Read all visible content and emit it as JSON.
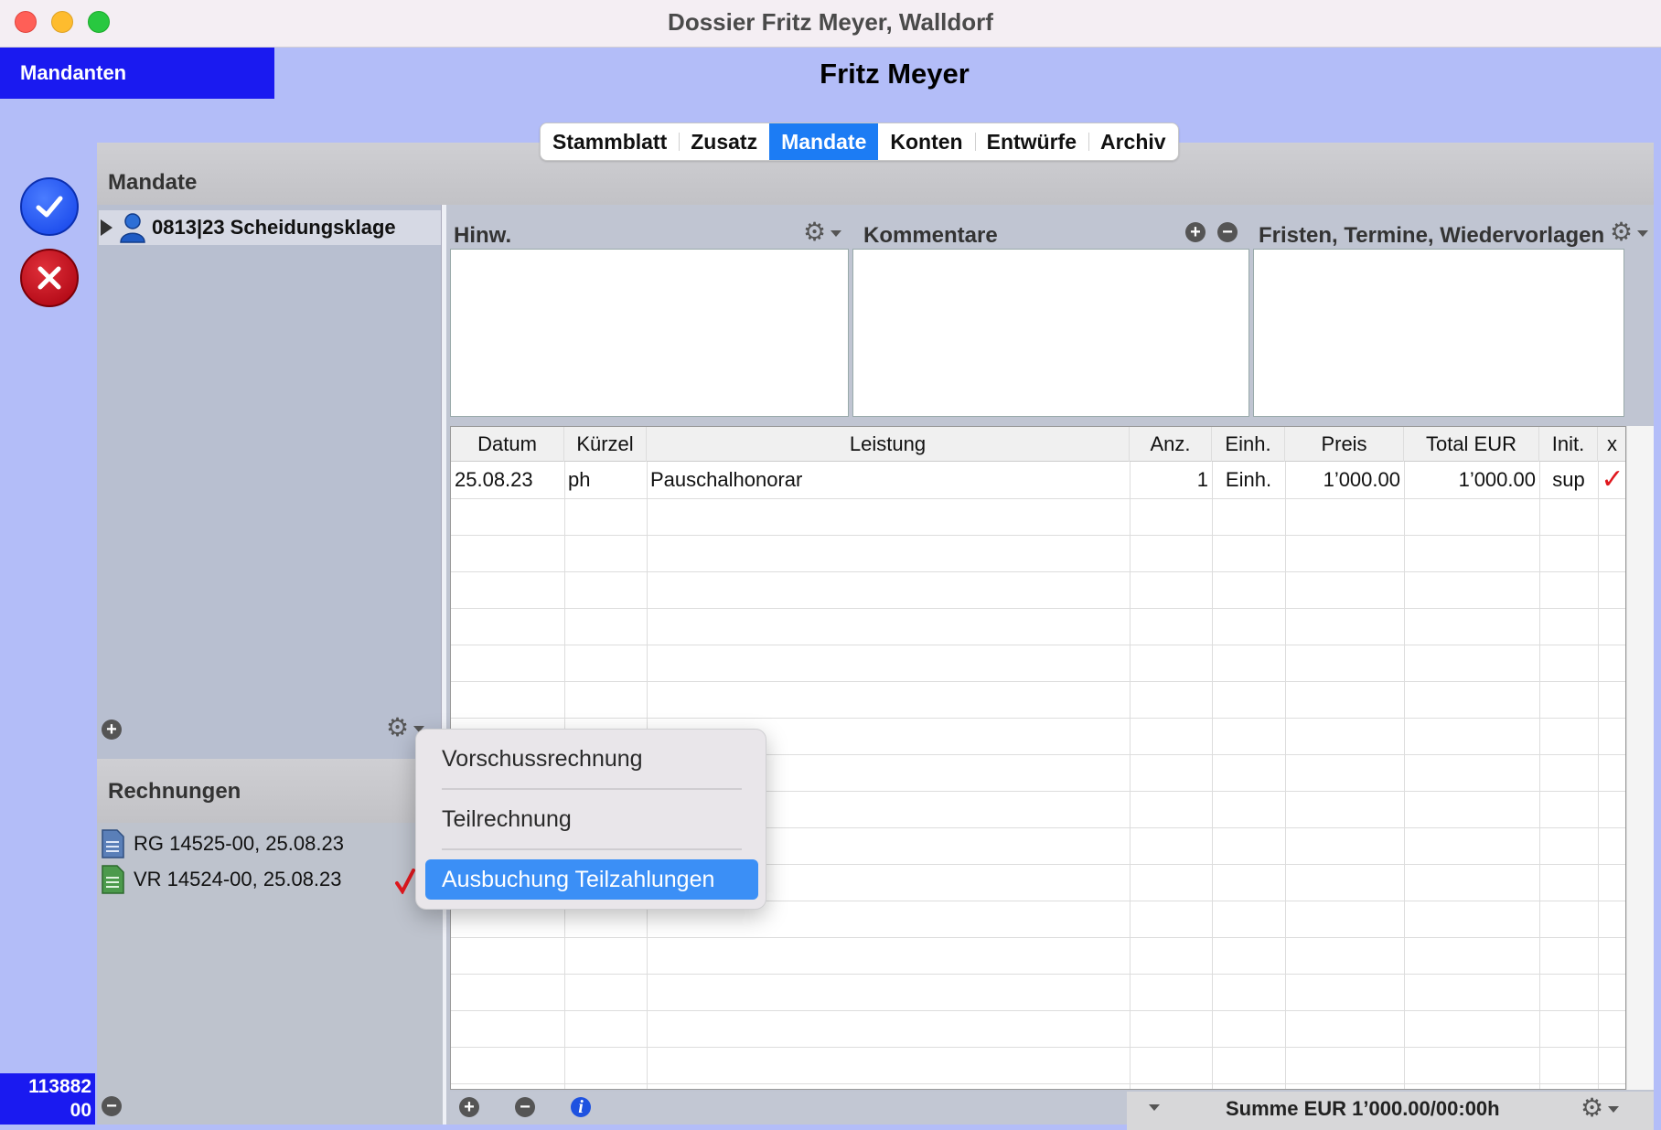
{
  "window": {
    "title": "Dossier Fritz Meyer, Walldorf"
  },
  "header": {
    "mandanten_label": "Mandanten",
    "client_name": "Fritz Meyer"
  },
  "tabs": [
    {
      "label": "Stammblatt",
      "active": false
    },
    {
      "label": "Zusatz",
      "active": false
    },
    {
      "label": "Mandate",
      "active": true
    },
    {
      "label": "Konten",
      "active": false
    },
    {
      "label": "Entwürfe",
      "active": false
    },
    {
      "label": "Archiv",
      "active": false
    }
  ],
  "mandate": {
    "title": "Mandate",
    "item": "0813|23 Scheidungsklage"
  },
  "rechnungen": {
    "title": "Rechnungen",
    "items": [
      {
        "label": "RG 14525-00, 25.08.23",
        "icon": "document-blue-icon"
      },
      {
        "label": "VR 14524-00, 25.08.23",
        "icon": "document-green-icon",
        "checked": true
      }
    ]
  },
  "sections": {
    "hinweise": "Hinw.",
    "kommentare": "Kommentare",
    "fristen": "Fristen, Termine, Wiedervorlagen"
  },
  "table": {
    "columns": [
      "Datum",
      "Kürzel",
      "Leistung",
      "Anz.",
      "Einh.",
      "Preis",
      "Total EUR",
      "Init.",
      "x"
    ],
    "rows": [
      {
        "datum": "25.08.23",
        "kuerzel": "ph",
        "leistung": "Pauschalhonorar",
        "anz": "1",
        "einh": "Einh.",
        "preis": "1’000.00",
        "total": "1’000.00",
        "init": "sup",
        "x": "✓"
      }
    ]
  },
  "summary": "Summe EUR 1’000.00/00:00h",
  "id_badge": {
    "line1": "113882",
    "line2": "00"
  },
  "context_menu": {
    "items": [
      "Vorschussrechnung",
      "Teilrechnung",
      "Ausbuchung Teilzahlungen"
    ],
    "highlighted": 2
  },
  "colors": {
    "accent_blue": "#1a1af0",
    "tab_active": "#1c7cf4",
    "menu_highlight": "#3b8ff6",
    "check_red": "#e0181e",
    "background": "#b3bdf8"
  }
}
